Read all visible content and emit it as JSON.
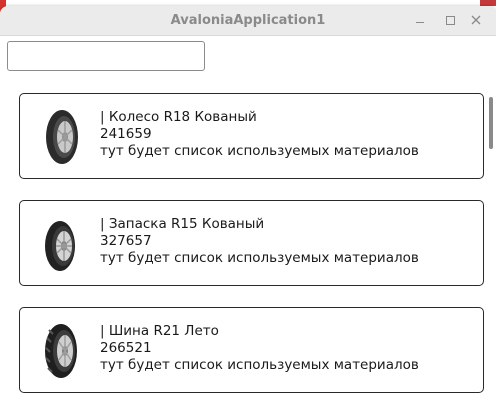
{
  "window": {
    "title": "AvaloniaApplication1"
  },
  "search": {
    "value": "",
    "placeholder": ""
  },
  "products": [
    {
      "title": "| Колесо R18 Кованый",
      "code": "241659",
      "materials": "тут будет список используемых  материалов",
      "icon": "tire-icon"
    },
    {
      "title": "| Запаска R15 Кованый",
      "code": "327657",
      "materials": "тут будет список используемых  материалов",
      "icon": "tire-icon"
    },
    {
      "title": "| Шина R21 Лето",
      "code": "266521",
      "materials": "тут будет список используемых  материалов",
      "icon": "tire-icon"
    }
  ]
}
